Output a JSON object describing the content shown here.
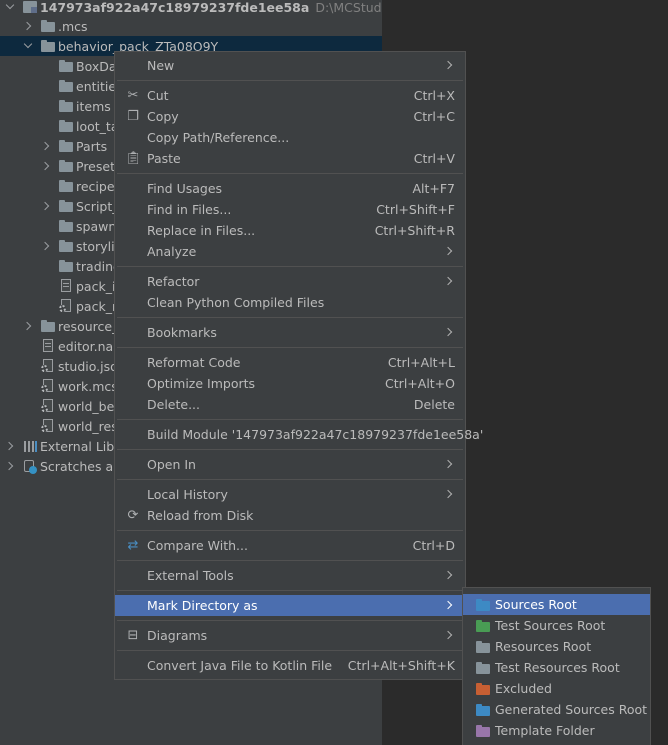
{
  "tree": {
    "root": {
      "name": "147973af922a47c18979237fde1ee58a",
      "path": "D:\\MCStudioDownlo"
    },
    "items": [
      {
        "label": ".mcs"
      },
      {
        "label": "behavior_pack_ZTa08O9Y"
      },
      {
        "label": "BoxDa"
      },
      {
        "label": "entities"
      },
      {
        "label": "items"
      },
      {
        "label": "loot_ta"
      },
      {
        "label": "Parts"
      },
      {
        "label": "Presets"
      },
      {
        "label": "recipes"
      },
      {
        "label": "Script_"
      },
      {
        "label": "spawn_"
      },
      {
        "label": "storylin"
      },
      {
        "label": "trading"
      },
      {
        "label": "pack_ic"
      },
      {
        "label": "pack_m"
      },
      {
        "label": "resource_"
      },
      {
        "label": "editor.nar"
      },
      {
        "label": "studio.jso"
      },
      {
        "label": "work.mcs"
      },
      {
        "label": "world_beh"
      },
      {
        "label": "world_res"
      },
      {
        "label": "External Libra"
      },
      {
        "label": "Scratches and"
      }
    ]
  },
  "menu": {
    "new": {
      "label": "New"
    },
    "cut": {
      "label": "Cut",
      "shortcut": "Ctrl+X"
    },
    "copy": {
      "label": "Copy",
      "shortcut": "Ctrl+C"
    },
    "copy_path": {
      "label": "Copy Path/Reference..."
    },
    "paste": {
      "label": "Paste",
      "shortcut": "Ctrl+V"
    },
    "find_usages": {
      "label": "Find Usages",
      "shortcut": "Alt+F7"
    },
    "find_in_files": {
      "label": "Find in Files...",
      "shortcut": "Ctrl+Shift+F"
    },
    "replace_in_files": {
      "label": "Replace in Files...",
      "shortcut": "Ctrl+Shift+R"
    },
    "analyze": {
      "label": "Analyze"
    },
    "refactor": {
      "label": "Refactor"
    },
    "clean_python": {
      "label": "Clean Python Compiled Files"
    },
    "bookmarks": {
      "label": "Bookmarks"
    },
    "reformat": {
      "label": "Reformat Code",
      "shortcut": "Ctrl+Alt+L"
    },
    "optimize_imports": {
      "label": "Optimize Imports",
      "shortcut": "Ctrl+Alt+O"
    },
    "delete": {
      "label": "Delete...",
      "shortcut": "Delete"
    },
    "build_module": {
      "label": "Build Module '147973af922a47c18979237fde1ee58a'"
    },
    "open_in": {
      "label": "Open In"
    },
    "local_history": {
      "label": "Local History"
    },
    "reload": {
      "label": "Reload from Disk"
    },
    "compare_with": {
      "label": "Compare With...",
      "shortcut": "Ctrl+D"
    },
    "external_tools": {
      "label": "External Tools"
    },
    "mark_directory": {
      "label": "Mark Directory as"
    },
    "diagrams": {
      "label": "Diagrams"
    },
    "convert_java": {
      "label": "Convert Java File to Kotlin File",
      "shortcut": "Ctrl+Alt+Shift+K"
    }
  },
  "submenu": {
    "items": [
      {
        "label": "Sources Root",
        "color": "#3d8ac4"
      },
      {
        "label": "Test Sources Root",
        "color": "#499c54"
      },
      {
        "label": "Resources Root",
        "color": "#87939a"
      },
      {
        "label": "Test Resources Root",
        "color": "#87939a"
      },
      {
        "label": "Excluded",
        "color": "#c75f33"
      },
      {
        "label": "Generated Sources Root",
        "color": "#3d8ac4"
      },
      {
        "label": "Template Folder",
        "color": "#9876aa"
      }
    ]
  }
}
